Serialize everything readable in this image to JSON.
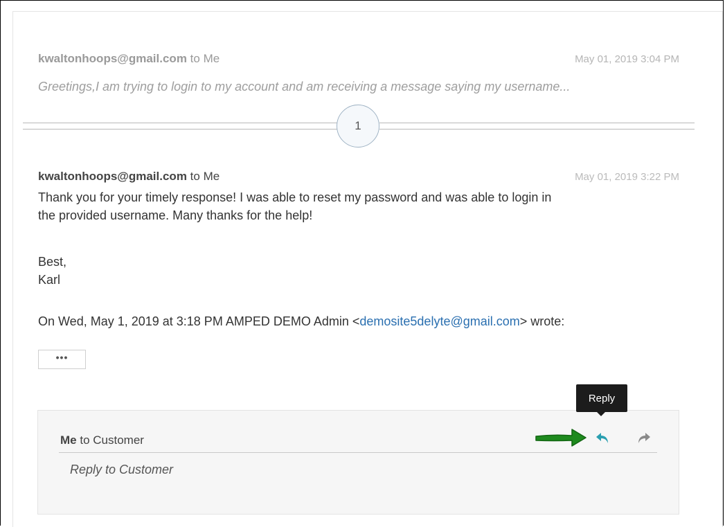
{
  "thread": {
    "first_message": {
      "sender": "kwaltonhoops@gmail.com",
      "recipient_text": "to Me",
      "date": "May 01, 2019 3:04 PM",
      "preview": "Greetings,I am trying to login to my account and am receiving a message saying my username..."
    },
    "collapsed_count": "1",
    "second_message": {
      "sender": "kwaltonhoops@gmail.com",
      "recipient_text": "to Me",
      "date": "May 01, 2019 3:22 PM",
      "body_line1": "Thank you for your timely response! I was able to reset my password and was able to login in",
      "body_line2": "the provided username. Many thanks for the help!",
      "body_line3": "Best,",
      "body_line4": "Karl",
      "quote_prefix": "On Wed, May 1, 2019 at 3:18 PM AMPED DEMO Admin <",
      "quote_email": "demosite5delyte@gmail.com",
      "quote_suffix": "> wrote:",
      "expand_label": "•••"
    }
  },
  "reply_box": {
    "from": "Me",
    "to_text": "to Customer",
    "placeholder": "Reply to Customer",
    "tooltip": "Reply",
    "reply_icon": "reply-icon",
    "forward_icon": "forward-icon"
  },
  "colors": {
    "reply_icon": "#2a9fb0",
    "forward_icon": "#8a8a8a",
    "annotation_arrow": "#1e8a1e",
    "link": "#2a6fb0"
  }
}
